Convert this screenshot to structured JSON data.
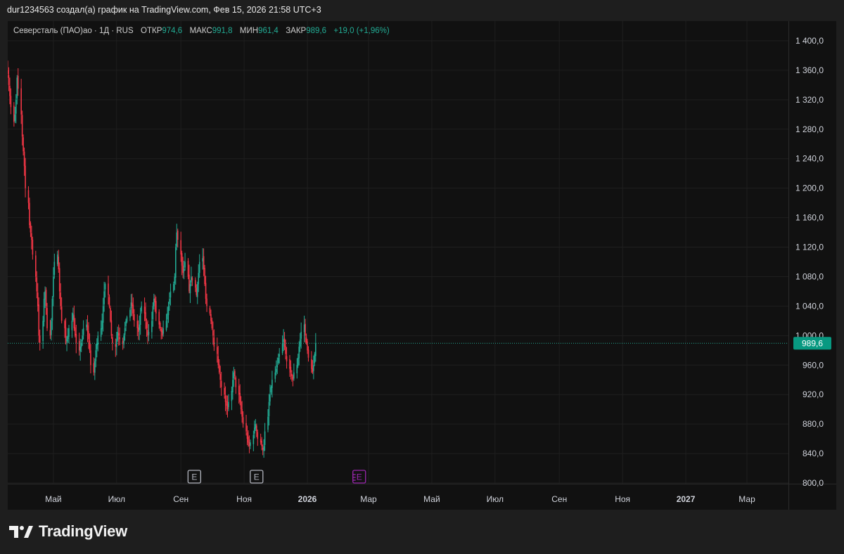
{
  "header": {
    "caption": "dur1234563 создал(а) график на TradingView.com, Фев 15, 2026 21:58 UTC+3"
  },
  "legend": {
    "symbol": "Северсталь (ПАО)ао · 1Д · RUS",
    "open_label": "ОТКР",
    "open_value": "974,6",
    "high_label": "МАКС",
    "high_value": "991,8",
    "low_label": "МИН",
    "low_value": "961,4",
    "close_label": "ЗАКР",
    "close_value": "989,6",
    "change": "+19,0 (+1,96%)"
  },
  "branding": {
    "logo_text": "TradingView"
  },
  "colors": {
    "up": "#22ab94",
    "down": "#f23645",
    "grid": "#1f1f1f",
    "price_label_bg": "#089981",
    "earnings_future": "#9c27b0",
    "axis_text": "#d1d4dc"
  },
  "chart_data": {
    "type": "candlestick",
    "y_axis": {
      "min": 800,
      "max": 1400,
      "position": "right",
      "ticks": [
        {
          "value": 1400,
          "label": "1 400,0"
        },
        {
          "value": 1360,
          "label": "1 360,0"
        },
        {
          "value": 1320,
          "label": "1 320,0"
        },
        {
          "value": 1280,
          "label": "1 280,0"
        },
        {
          "value": 1240,
          "label": "1 240,0"
        },
        {
          "value": 1200,
          "label": "1 200,0"
        },
        {
          "value": 1160,
          "label": "1 160,0"
        },
        {
          "value": 1120,
          "label": "1 120,0"
        },
        {
          "value": 1080,
          "label": "1 080,0"
        },
        {
          "value": 1040,
          "label": "1 040,0"
        },
        {
          "value": 1000,
          "label": "1 000,0"
        },
        {
          "value": 960,
          "label": "960,0"
        },
        {
          "value": 920,
          "label": "920,0"
        },
        {
          "value": 880,
          "label": "880,0"
        },
        {
          "value": 840,
          "label": "840,0"
        },
        {
          "value": 800,
          "label": "800,0"
        }
      ]
    },
    "x_axis": {
      "start": "2025-03-18",
      "end": "2027-04-10",
      "ticks": [
        {
          "date": "2025-05-01",
          "label": "Май",
          "bold": false
        },
        {
          "date": "2025-07-01",
          "label": "Июл",
          "bold": false
        },
        {
          "date": "2025-09-01",
          "label": "Сен",
          "bold": false
        },
        {
          "date": "2025-11-01",
          "label": "Ноя",
          "bold": false
        },
        {
          "date": "2026-01-01",
          "label": "2026",
          "bold": true
        },
        {
          "date": "2026-03-01",
          "label": "Мар",
          "bold": false
        },
        {
          "date": "2026-05-01",
          "label": "Май",
          "bold": false
        },
        {
          "date": "2026-07-01",
          "label": "Июл",
          "bold": false
        },
        {
          "date": "2026-09-01",
          "label": "Сен",
          "bold": false
        },
        {
          "date": "2026-11-01",
          "label": "Ноя",
          "bold": false
        },
        {
          "date": "2027-01-01",
          "label": "2027",
          "bold": true
        },
        {
          "date": "2027-03-01",
          "label": "Мар",
          "bold": false
        }
      ]
    },
    "last_price": {
      "value": 989.6,
      "label": "989,6"
    },
    "earnings_markers": [
      {
        "date": "2025-09-14",
        "label": "E",
        "state": "past"
      },
      {
        "date": "2025-11-13",
        "label": "E",
        "state": "past"
      },
      {
        "date": "2026-02-20",
        "label": "E",
        "state": "upcoming"
      }
    ],
    "series": {
      "name": "Северсталь (ПАО)ао",
      "start": "2025-03-18",
      "close": [
        1355,
        1340,
        1325,
        1310,
        1290,
        1300,
        1320,
        1350,
        1335,
        1300,
        1270,
        1250,
        1230,
        1200,
        1180,
        1150,
        1140,
        1130,
        1110,
        1080,
        1060,
        1040,
        1000,
        990,
        1020,
        1050,
        1060,
        1040,
        1010,
        1000,
        1020,
        1050,
        1080,
        1100,
        1110,
        1090,
        1060,
        1040,
        1020,
        1010,
        990,
        995,
        1000,
        1010,
        1020,
        1030,
        1010,
        1000,
        990,
        980,
        985,
        990,
        1000,
        1010,
        1015,
        1005,
        995,
        980,
        960,
        950,
        965,
        980,
        990,
        1000,
        1010,
        1020,
        1040,
        1060,
        1070,
        1055,
        1040,
        1020,
        1000,
        990,
        985,
        995,
        1005,
        1000,
        995,
        990,
        1000,
        1010,
        1020,
        1025,
        1035,
        1045,
        1040,
        1030,
        1020,
        1010,
        1005,
        1015,
        1030,
        1040,
        1030,
        1020,
        1010,
        1000,
        1005,
        1020,
        1040,
        1050,
        1045,
        1030,
        1015,
        1010,
        1005,
        1000,
        1010,
        1020,
        1030,
        1040,
        1050,
        1060,
        1070,
        1080,
        1120,
        1140,
        1130,
        1110,
        1095,
        1085,
        1090,
        1100,
        1080,
        1060,
        1070,
        1080,
        1075,
        1065,
        1055,
        1070,
        1085,
        1100,
        1105,
        1090,
        1070,
        1050,
        1040,
        1030,
        1020,
        1010,
        1000,
        985,
        975,
        960,
        950,
        940,
        930,
        920,
        910,
        905,
        900,
        910,
        925,
        940,
        950,
        945,
        930,
        920,
        910,
        900,
        890,
        880,
        870,
        860,
        855,
        850,
        855,
        865,
        875,
        880,
        870,
        860,
        855,
        850,
        845,
        850,
        870,
        890,
        910,
        920,
        930,
        940,
        950,
        955,
        960,
        970,
        975,
        990,
        995,
        985,
        975,
        965,
        955,
        950,
        945,
        940,
        950,
        960,
        970,
        985,
        995,
        1005,
        1015,
        1000,
        990,
        980,
        970,
        955,
        950,
        960,
        975,
        989.6
      ]
    }
  }
}
